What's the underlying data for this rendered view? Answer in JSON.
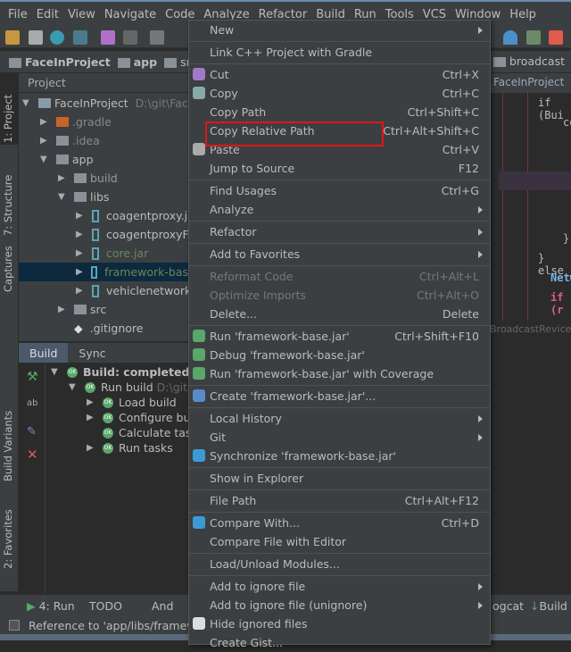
{
  "menubar": [
    "File",
    "Edit",
    "View",
    "Navigate",
    "Code",
    "Analyze",
    "Refactor",
    "Build",
    "Run",
    "Tools",
    "VCS",
    "Window",
    "Help"
  ],
  "breadcrumb": [
    "FaceInProject",
    "app",
    "src"
  ],
  "breadcrumb_right": "broadcast",
  "editor_tab": "FaceInProject",
  "editor_lines": [
    "if (Bui",
    "cor",
    "});",
    "} else",
    "Netw",
    "if (r"
  ],
  "editor_footer": "BroadcastRevice",
  "left_stripe": [
    "1: Project",
    "7: Structure",
    "Captures",
    "Build Variants",
    "2: Favorites"
  ],
  "project": {
    "header": "Project",
    "root": "FaceInProject",
    "root_path": "D:\\git\\Face",
    "items": [
      ".gradle",
      ".idea",
      "app",
      "build",
      "libs",
      "coagentproxy.j",
      "coagentproxyF",
      "core.jar",
      "framework-bas",
      "vehiclenetwork",
      "src",
      ".gitignore"
    ]
  },
  "build": {
    "tabs": [
      "Build",
      "Sync"
    ],
    "rows": [
      "Build: completed su",
      "Run build",
      "Load build",
      "Configure bu",
      "Calculate task",
      "Run tasks"
    ],
    "run_path": "D:\\git"
  },
  "bottom_tabs": [
    "4: Run",
    "TODO",
    "And",
    "ogcat",
    "Build"
  ],
  "status": "Reference to 'app/libs/framew",
  "menu": [
    {
      "label": "New",
      "sub": true
    },
    {
      "sep": true
    },
    {
      "label": "Link C++ Project with Gradle"
    },
    {
      "sep": true
    },
    {
      "label": "Cut",
      "shortcut": "Ctrl+X",
      "icon": "scissors"
    },
    {
      "label": "Copy",
      "shortcut": "Ctrl+C",
      "icon": "copy"
    },
    {
      "label": "Copy Path",
      "shortcut": "Ctrl+Shift+C"
    },
    {
      "label": "Copy Relative Path",
      "shortcut": "Ctrl+Alt+Shift+C"
    },
    {
      "label": "Paste",
      "shortcut": "Ctrl+V",
      "icon": "paste"
    },
    {
      "label": "Jump to Source",
      "shortcut": "F12"
    },
    {
      "sep": true
    },
    {
      "label": "Find Usages",
      "shortcut": "Ctrl+G"
    },
    {
      "label": "Analyze",
      "sub": true
    },
    {
      "sep": true
    },
    {
      "label": "Refactor",
      "sub": true
    },
    {
      "sep": true
    },
    {
      "label": "Add to Favorites",
      "sub": true
    },
    {
      "sep": true
    },
    {
      "label": "Reformat Code",
      "shortcut": "Ctrl+Alt+L",
      "disabled": true
    },
    {
      "label": "Optimize Imports",
      "shortcut": "Ctrl+Alt+O",
      "disabled": true
    },
    {
      "label": "Delete...",
      "shortcut": "Delete"
    },
    {
      "sep": true
    },
    {
      "label": "Run 'framework-base.jar'",
      "shortcut": "Ctrl+Shift+F10",
      "icon": "run"
    },
    {
      "label": "Debug 'framework-base.jar'",
      "icon": "debug"
    },
    {
      "label": "Run 'framework-base.jar' with Coverage",
      "icon": "coverage"
    },
    {
      "sep": true
    },
    {
      "label": "Create 'framework-base.jar'...",
      "icon": "create"
    },
    {
      "sep": true
    },
    {
      "label": "Local History",
      "sub": true
    },
    {
      "label": "Git",
      "sub": true
    },
    {
      "label": "Synchronize 'framework-base.jar'",
      "icon": "sync"
    },
    {
      "sep": true
    },
    {
      "label": "Show in Explorer"
    },
    {
      "sep": true
    },
    {
      "label": "File Path",
      "shortcut": "Ctrl+Alt+F12"
    },
    {
      "sep": true
    },
    {
      "label": "Compare With...",
      "shortcut": "Ctrl+D",
      "icon": "compare"
    },
    {
      "label": "Compare File with Editor"
    },
    {
      "sep": true
    },
    {
      "label": "Load/Unload Modules..."
    },
    {
      "sep": true
    },
    {
      "label": "Add to ignore file",
      "sub": true
    },
    {
      "label": "Add to ignore file (unignore)",
      "sub": true
    },
    {
      "label": "Hide ignored files",
      "icon": "ignore"
    },
    {
      "label": "Create Gist..."
    }
  ]
}
